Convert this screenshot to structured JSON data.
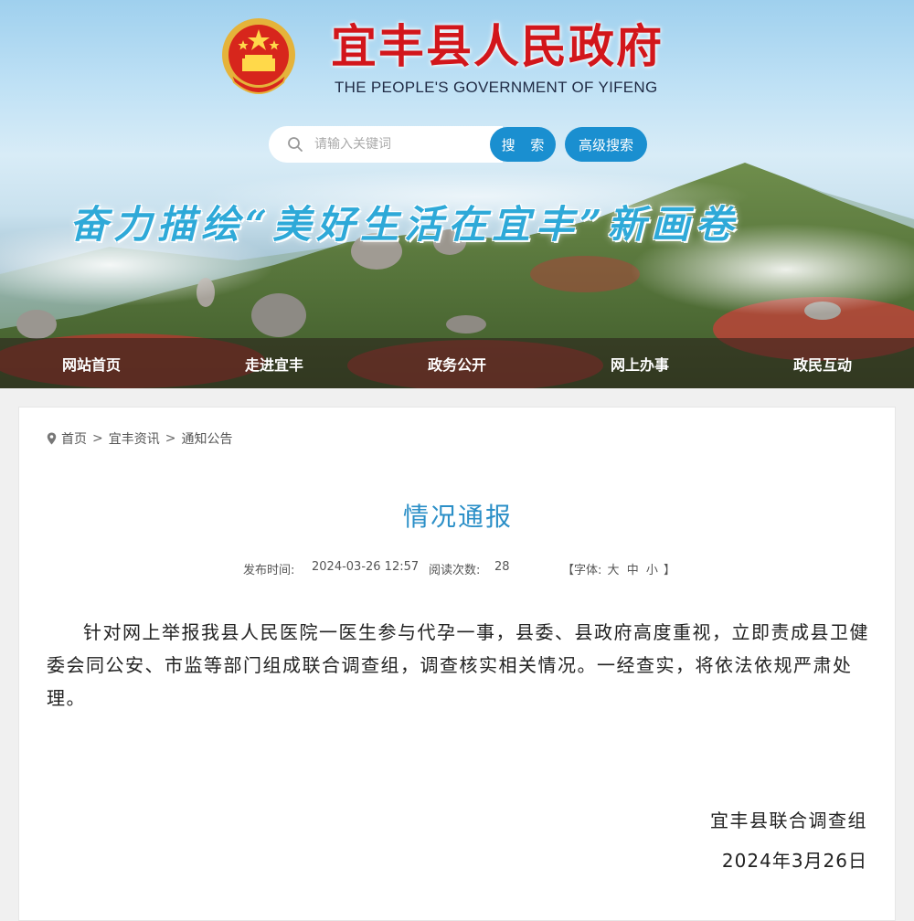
{
  "header": {
    "title": "宜丰县人民政府",
    "subtitle": "THE PEOPLE'S GOVERNMENT OF YIFENG",
    "slogan": "奋力描绘“美好生活在宜丰”新画卷"
  },
  "search": {
    "placeholder": "请输入关键词",
    "search_label": "搜 索",
    "advanced_label": "高级搜索"
  },
  "nav": {
    "items": [
      {
        "label": "网站首页"
      },
      {
        "label": "走进宜丰"
      },
      {
        "label": "政务公开"
      },
      {
        "label": "网上办事"
      },
      {
        "label": "政民互动"
      }
    ]
  },
  "breadcrumb": {
    "items": [
      "首页",
      "宜丰资讯",
      "通知公告"
    ],
    "separator": ">"
  },
  "article": {
    "title": "情况通报",
    "publish_label": "发布时间:",
    "publish_time": "2024-03-26 12:57",
    "read_label": "阅读次数:",
    "read_count": "28",
    "font_label": "【字体:",
    "font_large": "大",
    "font_medium": "中",
    "font_small": "小",
    "font_close": "】",
    "body": "针对网上举报我县人民医院一医生参与代孕一事，县委、县政府高度重视，立即责成县卫健委会同公安、市监等部门组成联合调查组，调查核实相关情况。一经查实，将依法依规严肃处理。",
    "signature": "宜丰县联合调查组",
    "date": "2024年3月26日"
  },
  "colors": {
    "title_red": "#d2161b",
    "accent_blue": "#1a8fd0",
    "article_title": "#2b8fc7",
    "slogan": "#2ea9d8"
  },
  "icons": {
    "emblem": "national-emblem-icon",
    "search": "search-icon",
    "location": "location-pin-icon"
  }
}
